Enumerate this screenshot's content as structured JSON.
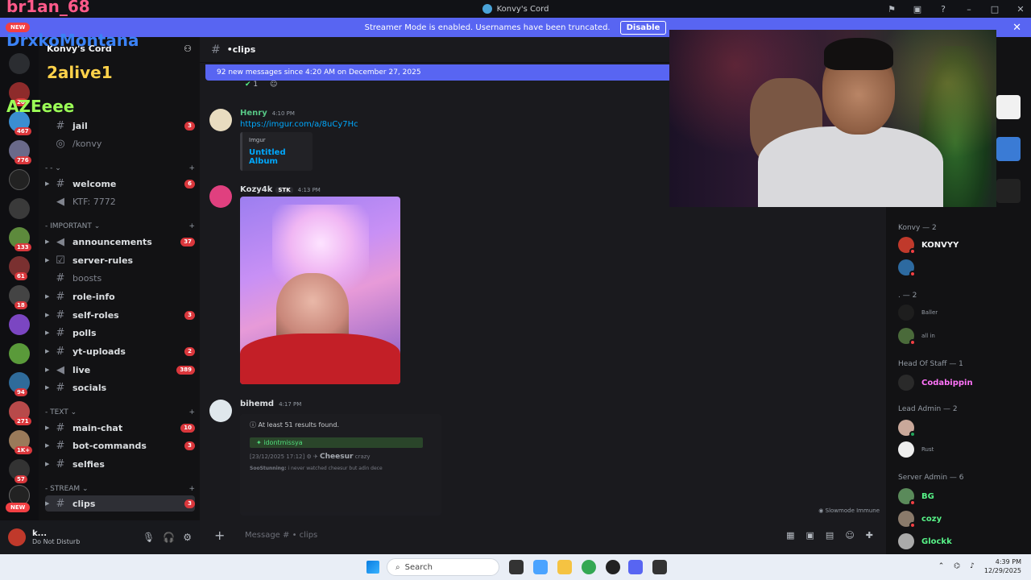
{
  "window": {
    "title": "Konvy's Cord"
  },
  "banner": {
    "text": "Streamer Mode is enabled. Usernames have been truncated.",
    "button": "Disable"
  },
  "server": {
    "name": "Konvy's Cord"
  },
  "rail": {
    "badges": [
      "20",
      "467",
      "776",
      "133",
      "61",
      "18",
      "94",
      "271",
      "1K+",
      "57"
    ],
    "new_top": "NEW",
    "new_bottom": "NEW"
  },
  "channels": {
    "top": [
      {
        "name": "jail",
        "count": "3"
      },
      {
        "name": "/konvy",
        "count": ""
      }
    ],
    "uncat": [
      {
        "name": "welcome",
        "count": "6"
      },
      {
        "name": "KTF: 7772",
        "count": ""
      }
    ],
    "cat_important": "IMPORTANT",
    "important": [
      {
        "name": "announcements",
        "count": "37"
      },
      {
        "name": "server-rules",
        "count": ""
      },
      {
        "name": "boosts",
        "count": ""
      },
      {
        "name": "role-info",
        "count": ""
      },
      {
        "name": "self-roles",
        "count": "3"
      },
      {
        "name": "polls",
        "count": ""
      },
      {
        "name": "yt-uploads",
        "count": "2"
      },
      {
        "name": "live",
        "count": "389"
      },
      {
        "name": "socials",
        "count": ""
      }
    ],
    "cat_text": "TEXT",
    "text": [
      {
        "name": "main-chat",
        "count": "10"
      },
      {
        "name": "bot-commands",
        "count": "3"
      },
      {
        "name": "selfies",
        "count": ""
      }
    ],
    "cat_stream": "STREAM",
    "stream": [
      {
        "name": "clips",
        "count": "3"
      }
    ]
  },
  "user": {
    "name": "k...",
    "status": "Do Not Disturb"
  },
  "chat": {
    "channel": "clips",
    "new_messages": "92 new messages since 4:20 AM on December 27, 2025",
    "reaction_count": "1",
    "messages": [
      {
        "author": "Henry",
        "time": "4:10 PM",
        "link": "https://imgur.com/a/8uCy7Hc",
        "embed_provider": "Imgur",
        "embed_title": "Untitled Album"
      },
      {
        "author": "Kozy4k",
        "tag": "STK",
        "time": "4:13 PM"
      },
      {
        "author": "bihemd",
        "time": "4:17 PM",
        "bot_results": "At least 51 results found.",
        "bot_user": "idontmissya",
        "bot_meta": "[23/12/2025 17:12]",
        "bot_name": "Cheesur",
        "bot_sub": "crazy",
        "bot_quote_author": "SooStunning:",
        "bot_quote": "i never watched cheesur but adin dece"
      }
    ],
    "placeholder": "Message # • clips",
    "slowmode": "Slowmode Immune"
  },
  "members": {
    "groups": [
      {
        "label": "Konvy — 2"
      },
      {
        "label": ". — 2"
      },
      {
        "label": "Head Of Staff — 1"
      },
      {
        "label": "Lead Admin — 2"
      },
      {
        "label": "Server Admin — 6"
      }
    ],
    "items": [
      {
        "name": "KONVYY",
        "sub": "",
        "color": "#f2f3f5"
      },
      {
        "name": "Baller",
        "sub": "",
        "color": "#949ba4"
      },
      {
        "name": "all in",
        "sub": "",
        "color": "#949ba4"
      },
      {
        "name": "Codabippin",
        "sub": "",
        "color": "#ff73fa"
      },
      {
        "name": "Rust",
        "sub": "",
        "color": "#949ba4"
      },
      {
        "name": "BG",
        "sub": "",
        "color": "#57f287"
      },
      {
        "name": "cozy",
        "sub": "",
        "color": "#57f287"
      },
      {
        "name": "Glockk",
        "sub": "",
        "color": "#57f287"
      }
    ]
  },
  "overlay": {
    "lines": [
      {
        "name": "br1an_68",
        "color": "#ff5a8a"
      },
      {
        "name": "DrxkoMontana",
        "color": "#3b82f6"
      },
      {
        "name": "2alive1",
        "color": "#ffd24a"
      },
      {
        "name": "AZEeee",
        "color": "#9cff57"
      }
    ]
  },
  "taskbar": {
    "search": "Search",
    "time": "4:39 PM",
    "date": "12/29/2025"
  }
}
